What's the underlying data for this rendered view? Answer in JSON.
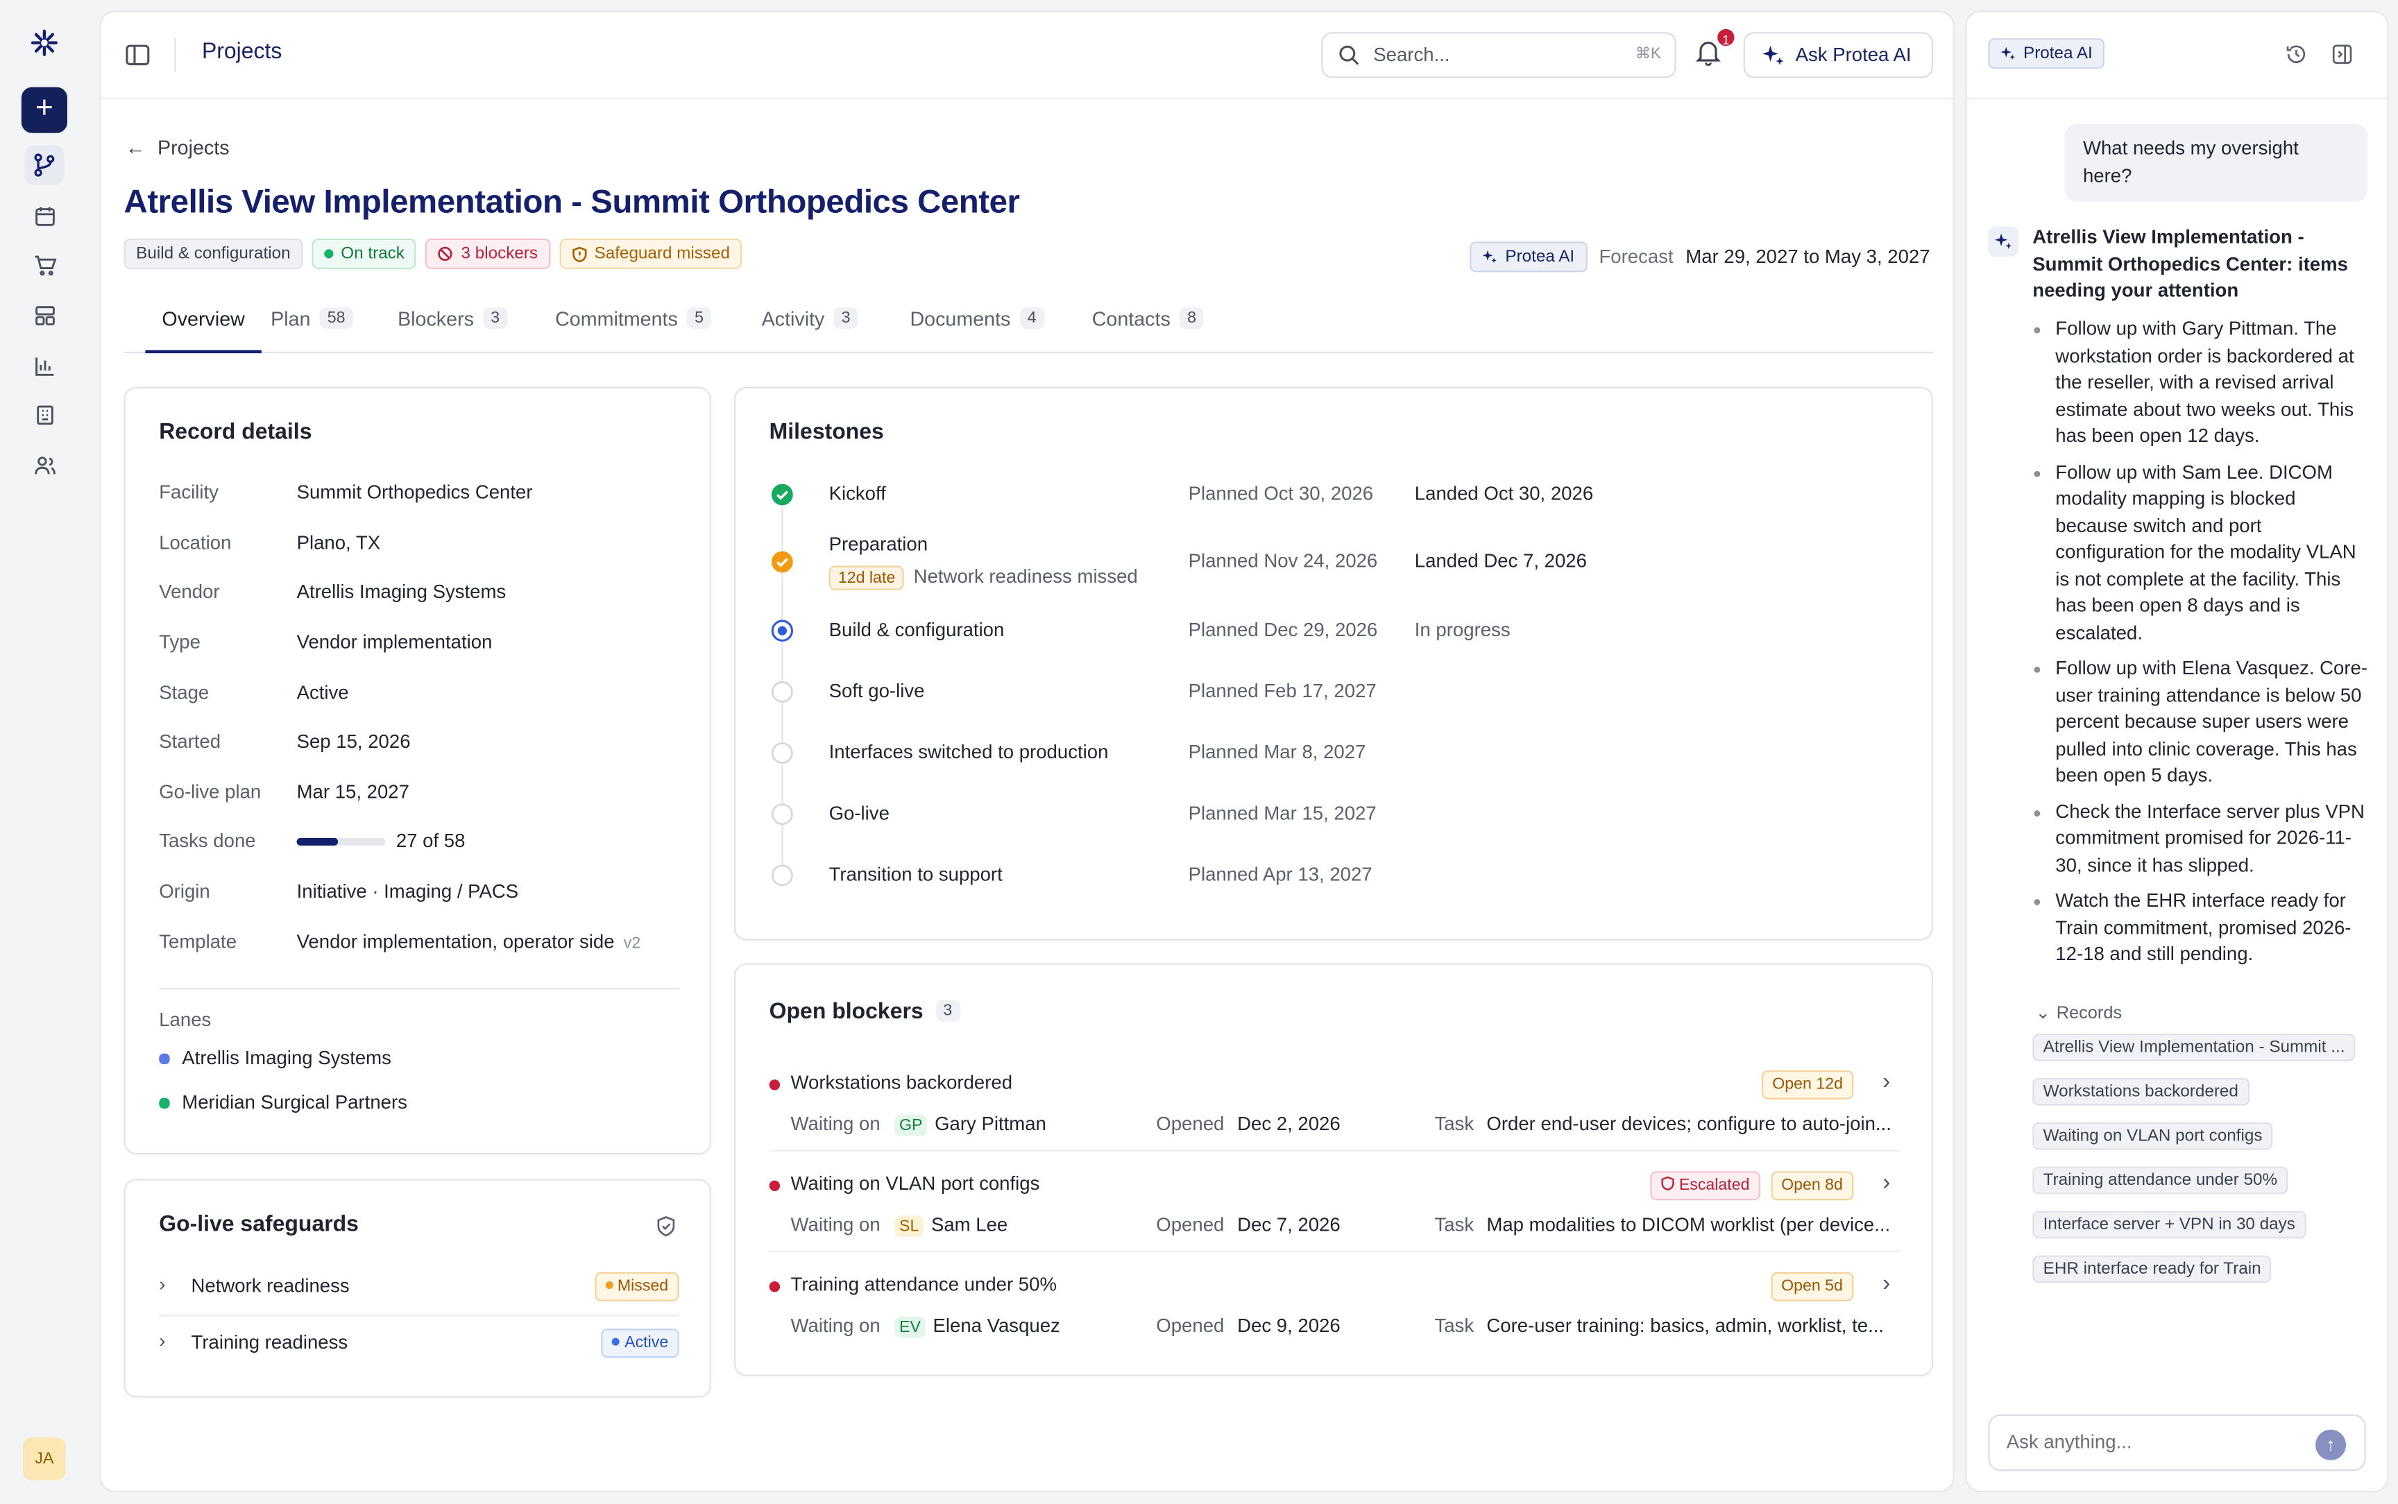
{
  "app": {
    "accent": "#14206b",
    "user_initials": "JA"
  },
  "topbar": {
    "title": "Projects",
    "search_placeholder": "Search...",
    "search_shortcut": "⌘K",
    "notification_count": "1",
    "ask_ai_label": "Ask Protea AI"
  },
  "breadcrumb": {
    "label": "Projects"
  },
  "project": {
    "title": "Atrellis View Implementation - Summit Orthopedics Center",
    "chips": {
      "phase": "Build & configuration",
      "status": "On track",
      "blockers": "3 blockers",
      "safeguard": "Safeguard missed"
    },
    "ai_chip": "Protea AI",
    "forecast_label": "Forecast",
    "forecast_value": "Mar 29, 2027 to May 3, 2027"
  },
  "tabs": [
    {
      "label": "Overview",
      "count": ""
    },
    {
      "label": "Plan",
      "count": "58"
    },
    {
      "label": "Blockers",
      "count": "3"
    },
    {
      "label": "Commitments",
      "count": "5"
    },
    {
      "label": "Activity",
      "count": "3"
    },
    {
      "label": "Documents",
      "count": "4"
    },
    {
      "label": "Contacts",
      "count": "8"
    }
  ],
  "record_details": {
    "title": "Record details",
    "rows": [
      {
        "key": "Facility",
        "value": "Summit Orthopedics Center"
      },
      {
        "key": "Location",
        "value": "Plano, TX"
      },
      {
        "key": "Vendor",
        "value": "Atrellis Imaging Systems"
      },
      {
        "key": "Type",
        "value": "Vendor implementation"
      },
      {
        "key": "Stage",
        "value": "Active"
      },
      {
        "key": "Started",
        "value": "Sep 15, 2026"
      },
      {
        "key": "Go-live plan",
        "value": "Mar 15, 2027"
      },
      {
        "key": "Tasks done",
        "value": "27 of 58"
      },
      {
        "key": "Origin",
        "value": "Initiative · Imaging / PACS"
      },
      {
        "key": "Template",
        "value": "Vendor implementation, operator side"
      }
    ],
    "template_version": "v2",
    "tasks_progress": 0.466,
    "lanes_label": "Lanes",
    "lanes": [
      {
        "name": "Atrellis Imaging Systems",
        "color": "#5b7be6"
      },
      {
        "name": "Meridian Surgical Partners",
        "color": "#18b06a"
      }
    ]
  },
  "safeguards": {
    "title": "Go-live safeguards",
    "items": [
      {
        "name": "Network readiness",
        "status": "Missed"
      },
      {
        "name": "Training readiness",
        "status": "Active"
      }
    ]
  },
  "milestones": {
    "title": "Milestones",
    "items": [
      {
        "name": "Kickoff",
        "planned": "Planned Oct 30, 2026",
        "landed": "Landed Oct 30, 2026",
        "state": "done"
      },
      {
        "name": "Preparation",
        "late": "12d late",
        "note": "Network readiness missed",
        "planned": "Planned Nov 24, 2026",
        "landed": "Landed Dec 7, 2026",
        "state": "late"
      },
      {
        "name": "Build & configuration",
        "planned": "Planned Dec 29, 2026",
        "landed": "In progress",
        "state": "current"
      },
      {
        "name": "Soft go-live",
        "planned": "Planned Feb 17, 2027",
        "landed": "",
        "state": "todo"
      },
      {
        "name": "Interfaces switched to production",
        "planned": "Planned Mar 8, 2027",
        "landed": "",
        "state": "todo"
      },
      {
        "name": "Go-live",
        "planned": "Planned Mar 15, 2027",
        "landed": "",
        "state": "todo"
      },
      {
        "name": "Transition to support",
        "planned": "Planned Apr 13, 2027",
        "landed": "",
        "state": "todo"
      }
    ]
  },
  "blockers": {
    "title": "Open blockers",
    "count": "3",
    "waiting_label": "Waiting on",
    "opened_label": "Opened",
    "task_label": "Task",
    "items": [
      {
        "title": "Workstations backordered",
        "tag": "Open 12d",
        "escalated": "",
        "initials": "GP",
        "person": "Gary Pittman",
        "opened": "Dec 2, 2026",
        "task": "Order end-user devices; configure to auto-join..."
      },
      {
        "title": "Waiting on VLAN port configs",
        "tag": "Open 8d",
        "escalated": "Escalated",
        "initials": "SL",
        "person": "Sam Lee",
        "opened": "Dec 7, 2026",
        "task": "Map modalities to DICOM worklist (per device..."
      },
      {
        "title": "Training attendance under 50%",
        "tag": "Open 5d",
        "escalated": "",
        "initials": "EV",
        "person": "Elena Vasquez",
        "opened": "Dec 9, 2026",
        "task": "Core-user training: basics, admin, worklist, te..."
      }
    ]
  },
  "ai_panel": {
    "chip": "Protea AI",
    "question": "What needs my oversight here?",
    "answer_title": "Atrellis View Implementation - Summit Orthopedics Center: items needing your attention",
    "bullets": [
      "Follow up with Gary Pittman. The workstation order is backordered at the reseller, with a revised arrival estimate about two weeks out. This has been open 12 days.",
      "Follow up with Sam Lee. DICOM modality mapping is blocked because switch and port configuration for the modality VLAN is not complete at the facility. This has been open 8 days and is escalated.",
      "Follow up with Elena Vasquez. Core-user training attendance is below 50 percent because super users were pulled into clinic coverage. This has been open 5 days.",
      "Check the Interface server plus VPN commitment promised for 2026-11-30, since it has slipped.",
      "Watch the EHR interface ready for Train commitment, promised 2026-12-18 and still pending."
    ],
    "records_label": "Records",
    "records": [
      "Atrellis View Implementation - Summit ...",
      "Workstations backordered",
      "Waiting on VLAN port configs",
      "Training attendance under 50%",
      "Interface server + VPN in 30 days",
      "EHR interface ready for Train"
    ],
    "input_placeholder": "Ask anything..."
  }
}
